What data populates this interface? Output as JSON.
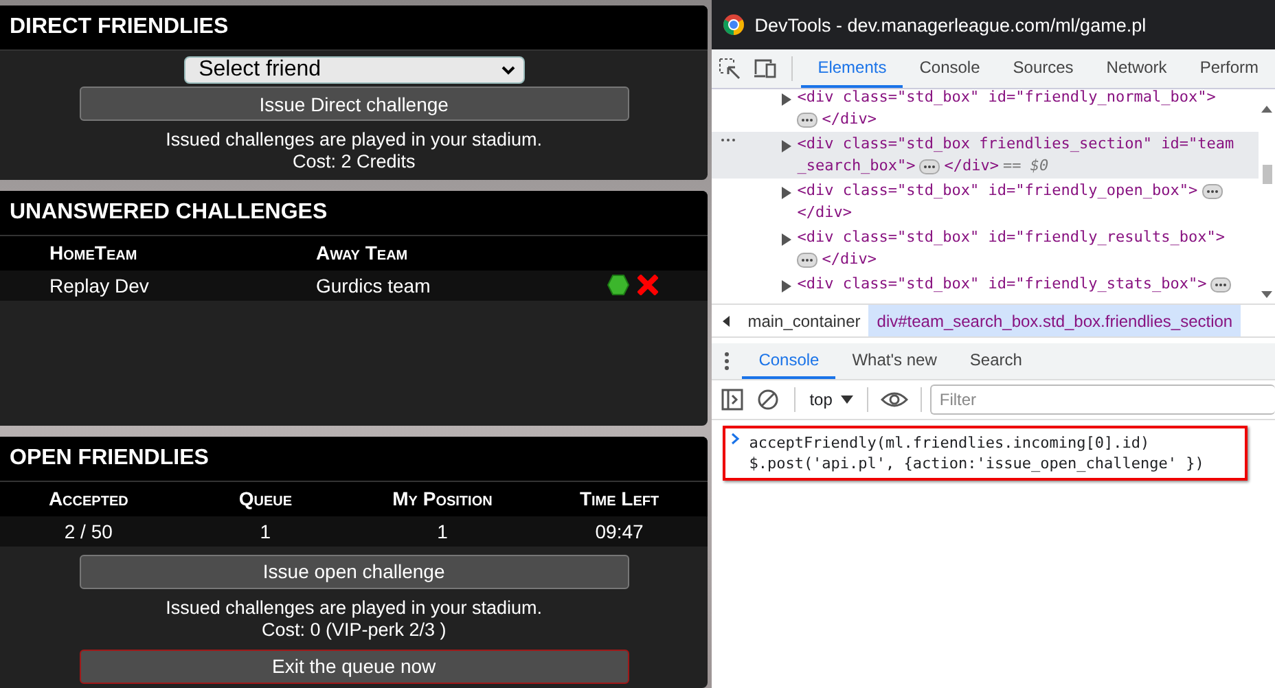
{
  "direct_friendlies": {
    "title": "DIRECT FRIENDLIES",
    "select": {
      "value": "Select friend"
    },
    "button": "Issue Direct challenge",
    "notes": [
      "Issued challenges are played in your stadium.",
      "Cost: 2 Credits"
    ]
  },
  "unanswered_challenges": {
    "title": "UNANSWERED CHALLENGES",
    "columns": [
      "HomeTeam",
      "Away Team"
    ],
    "rows": [
      {
        "home": "Replay Dev",
        "away": "Gurdics team"
      }
    ]
  },
  "open_friendlies": {
    "title": "OPEN FRIENDLIES",
    "columns": [
      "Accepted",
      "Queue",
      "My Position",
      "Time Left"
    ],
    "values": [
      "2 / 50",
      "1",
      "1",
      "09:47"
    ],
    "button": "Issue open challenge",
    "notes": [
      "Issued challenges are played in your stadium.",
      "Cost: 0 (VIP-perk 2/3 )"
    ],
    "exit_button": "Exit the queue now"
  },
  "devtools": {
    "title": "DevTools - dev.managerleague.com/ml/game.pl",
    "tabs": [
      {
        "label": "Elements",
        "selected": true
      },
      {
        "label": "Console",
        "selected": false
      },
      {
        "label": "Sources",
        "selected": false
      },
      {
        "label": "Network",
        "selected": false
      },
      {
        "label": "Perform",
        "selected": false
      }
    ],
    "nodes": [
      {
        "selected": false,
        "expanded": false,
        "lines": [
          [
            {
              "kind": "tag",
              "text": "<div class=\"std_box\" id=\"friendly_normal_box\">"
            }
          ],
          [
            {
              "kind": "ellipsis"
            },
            {
              "kind": "tag",
              "text": "</div>"
            }
          ]
        ]
      },
      {
        "selected": true,
        "expanded": false,
        "lines": [
          [
            {
              "kind": "tag",
              "text": "<div class=\"std_box friendlies_section\" id=\"team"
            }
          ],
          [
            {
              "kind": "tag",
              "text": "_search_box\">"
            },
            {
              "kind": "ellipsis"
            },
            {
              "kind": "tag",
              "text": "</div>"
            },
            {
              "kind": "note",
              "text": "== $0"
            }
          ]
        ]
      },
      {
        "selected": false,
        "expanded": false,
        "lines": [
          [
            {
              "kind": "tag",
              "text": "<div class=\"std_box\" id=\"friendly_open_box\">"
            },
            {
              "kind": "ellipsis"
            }
          ],
          [
            {
              "kind": "tag",
              "text": "</div>"
            }
          ]
        ]
      },
      {
        "selected": false,
        "expanded": false,
        "lines": [
          [
            {
              "kind": "tag",
              "text": "<div class=\"std_box\" id=\"friendly_results_box\">"
            }
          ],
          [
            {
              "kind": "ellipsis"
            },
            {
              "kind": "tag",
              "text": "</div>"
            }
          ]
        ]
      },
      {
        "selected": false,
        "expanded": false,
        "lines": [
          [
            {
              "kind": "tag",
              "text": "<div class=\"std_box\" id=\"friendly_stats_box\">"
            },
            {
              "kind": "ellipsis"
            }
          ]
        ]
      }
    ],
    "breadcrumbs": [
      {
        "label": "main_container",
        "selected": false
      },
      {
        "label": "div#team_search_box.std_box.friendlies_section",
        "selected": true
      }
    ],
    "drawer_tabs": [
      {
        "label": "Console",
        "selected": true
      },
      {
        "label": "What's new",
        "selected": false
      },
      {
        "label": "Search",
        "selected": false
      }
    ],
    "context": "top",
    "filter_placeholder": "Filter",
    "console_input": [
      "acceptFriendly(ml.friendlies.incoming[0].id)",
      "$.post('api.pl', {action:'issue_open_challenge' })"
    ]
  }
}
